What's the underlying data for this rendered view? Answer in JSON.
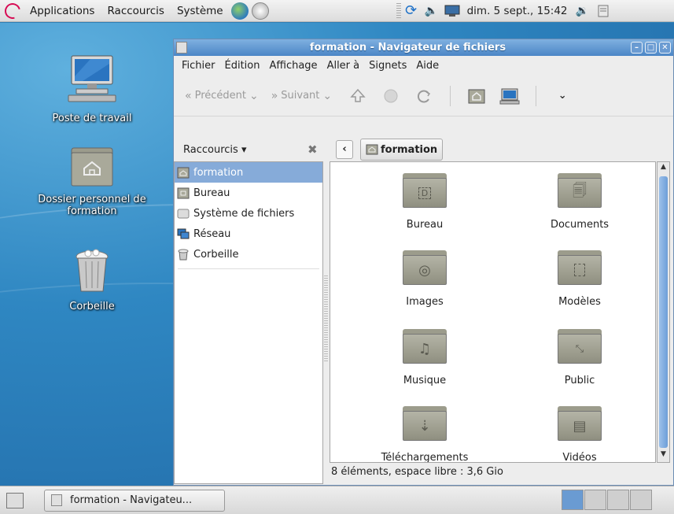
{
  "top_panel": {
    "menus": [
      "Applications",
      "Raccourcis",
      "Système"
    ],
    "clock": "dim.  5 sept., 15:42"
  },
  "desktop": {
    "icons": [
      {
        "label": "Poste de travail"
      },
      {
        "label": "Dossier personnel de formation"
      },
      {
        "label": "Corbeille"
      }
    ]
  },
  "window": {
    "title": "formation - Navigateur de fichiers",
    "menus": [
      "Fichier",
      "Édition",
      "Affichage",
      "Aller à",
      "Signets",
      "Aide"
    ],
    "toolbar": {
      "back_label": "Précédent",
      "forward_label": "Suivant"
    },
    "sidebar": {
      "title": "Raccourcis",
      "places": [
        "formation",
        "Bureau",
        "Système de fichiers",
        "Réseau",
        "Corbeille"
      ]
    },
    "location": {
      "current": "formation"
    },
    "files": [
      "Bureau",
      "Documents",
      "Images",
      "Modèles",
      "Musique",
      "Public",
      "Téléchargements",
      "Vidéos"
    ],
    "status": "8 éléments, espace libre : 3,6 Gio"
  },
  "bottom_panel": {
    "task_label": "formation - Navigateu..."
  },
  "colors": {
    "selection": "#86abd9",
    "titlebar": "#4b86c6",
    "desktop": "#2f87c2",
    "folder": "#9c9c8c"
  }
}
